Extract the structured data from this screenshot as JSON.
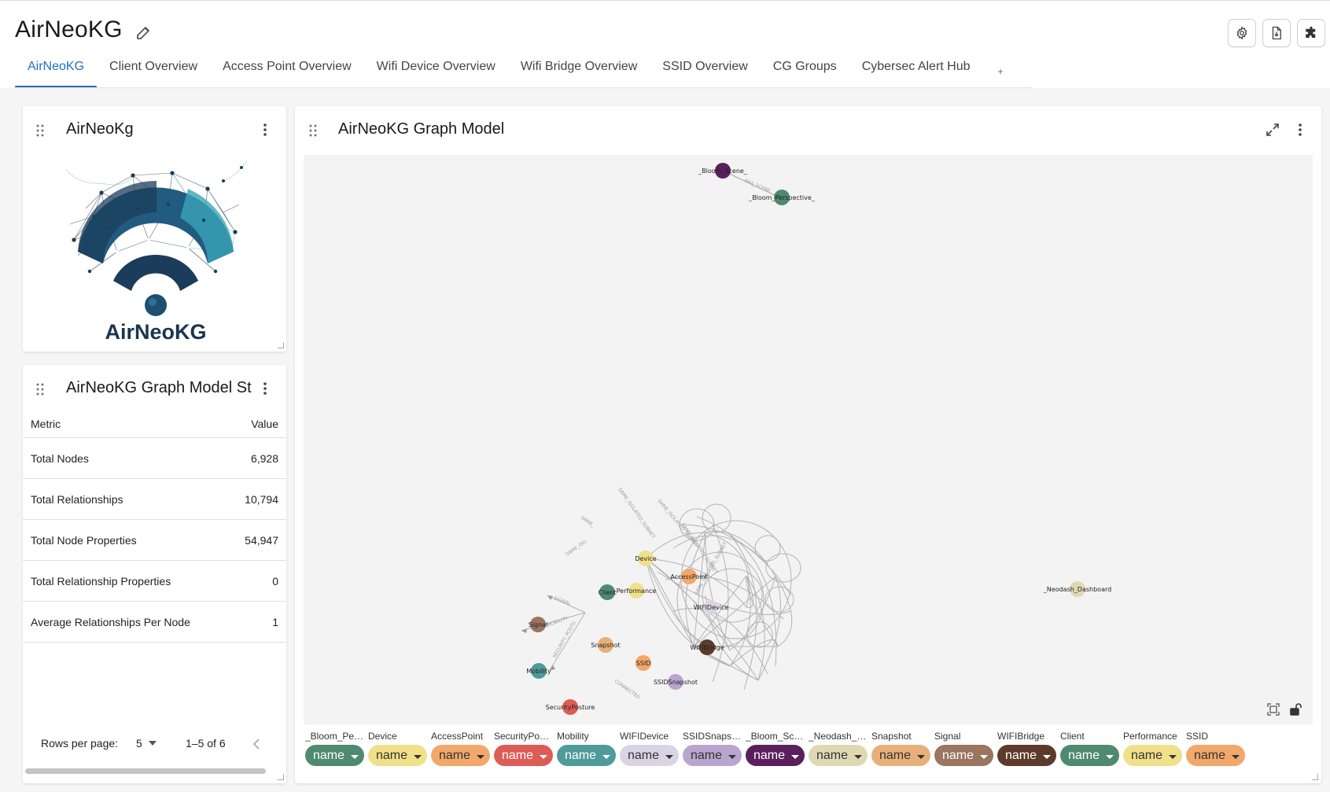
{
  "app": {
    "title": "AirNeoKG"
  },
  "header_buttons": [
    {
      "icon": "gear-icon"
    },
    {
      "icon": "export-file-icon"
    },
    {
      "icon": "puzzle-extension-icon"
    }
  ],
  "tabs": [
    {
      "label": "AirNeoKG",
      "active": true
    },
    {
      "label": "Client Overview"
    },
    {
      "label": "Access Point Overview"
    },
    {
      "label": "Wifi Device Overview"
    },
    {
      "label": "Wifi Bridge Overview"
    },
    {
      "label": "SSID Overview"
    },
    {
      "label": "CG Groups"
    },
    {
      "label": "Cybersec Alert Hub"
    }
  ],
  "logo_card": {
    "title": "AirNeoKg",
    "logo_text": "AirNeoKG"
  },
  "stats_card": {
    "title": "AirNeoKG Graph Model St",
    "columns": {
      "metric": "Metric",
      "value": "Value"
    },
    "rows": [
      {
        "metric": "Total Nodes",
        "value": "6,928"
      },
      {
        "metric": "Total Relationships",
        "value": "10,794"
      },
      {
        "metric": "Total Node Properties",
        "value": "54,947"
      },
      {
        "metric": "Total Relationship Properties",
        "value": "0"
      },
      {
        "metric": "Average Relationships Per Node",
        "value": "1"
      }
    ],
    "pagination": {
      "rows_per_page_label": "Rows per page:",
      "rows_per_page": "5",
      "range": "1–5 of 6"
    }
  },
  "graph_card": {
    "title": "AirNeoKG Graph Model",
    "nodes": [
      {
        "label": "_Bloom_Scene_",
        "color": "#5b1f5e"
      },
      {
        "label": "_Bloom_Perspective_",
        "color": "#4e8a6f"
      },
      {
        "label": "_Neodash_Dashboard",
        "color": "#dfd9b3"
      },
      {
        "label": "Device",
        "color": "#f1e08a"
      },
      {
        "label": "AccessPoint",
        "color": "#f2a86b"
      },
      {
        "label": "Client",
        "color": "#4e8a6f"
      },
      {
        "label": "Performance",
        "color": "#f1e08a"
      },
      {
        "label": "WIFIDevice",
        "color": "#d9d4e4"
      },
      {
        "label": "WIFIBridge",
        "color": "#5c3b2a"
      },
      {
        "label": "Signal",
        "color": "#9a7560"
      },
      {
        "label": "Snapshot",
        "color": "#e7b07a"
      },
      {
        "label": "SSID",
        "color": "#f2a86b"
      },
      {
        "label": "SSIDSnapshot",
        "color": "#b9a5cf"
      },
      {
        "label": "Mobility",
        "color": "#4f9a9b"
      },
      {
        "label": "SecurityPosture",
        "color": "#dd5c56"
      }
    ],
    "edge_labels": [
      "SAME_ISOLATED_SUBNET",
      "SAME_ISOLATED_SUBNET",
      "SAME_ISOLATED_SUBNET",
      "SAME_ISOLATED_SUBNET",
      "SAME_",
      "SAME_ISO",
      "SIGNAL",
      "MOBILITY",
      "SECURITY_POSTU",
      "HAS_SCENE",
      "CONNECTED"
    ],
    "legend": [
      {
        "label": "_Bloom_Pers…",
        "value": "name",
        "color": "#4e8a6f",
        "text_color": "#ffffff"
      },
      {
        "label": "Device",
        "value": "name",
        "color": "#f1e08a",
        "text_color": "#333333"
      },
      {
        "label": "AccessPoint",
        "value": "name",
        "color": "#f2a86b",
        "text_color": "#333333"
      },
      {
        "label": "SecurityPost…",
        "value": "name",
        "color": "#dd5c56",
        "text_color": "#ffffff"
      },
      {
        "label": "Mobility",
        "value": "name",
        "color": "#4f9a9b",
        "text_color": "#ffffff"
      },
      {
        "label": "WIFIDevice",
        "value": "name",
        "color": "#d9d4e4",
        "text_color": "#333333"
      },
      {
        "label": "SSIDSnapshot",
        "value": "name",
        "color": "#b9a5cf",
        "text_color": "#333333"
      },
      {
        "label": "_Bloom_Sce…",
        "value": "name",
        "color": "#5b1f5e",
        "text_color": "#ffffff"
      },
      {
        "label": "_Neodash_D…",
        "value": "name",
        "color": "#dfd9b3",
        "text_color": "#333333"
      },
      {
        "label": "Snapshot",
        "value": "name",
        "color": "#e7b07a",
        "text_color": "#333333"
      },
      {
        "label": "Signal",
        "value": "name",
        "color": "#9a7560",
        "text_color": "#ffffff"
      },
      {
        "label": "WIFIBridge",
        "value": "name",
        "color": "#5c3b2a",
        "text_color": "#ffffff"
      },
      {
        "label": "Client",
        "value": "name",
        "color": "#4e8a6f",
        "text_color": "#ffffff"
      },
      {
        "label": "Performance",
        "value": "name",
        "color": "#f1e08a",
        "text_color": "#333333"
      },
      {
        "label": "SSID",
        "value": "name",
        "color": "#f2a86b",
        "text_color": "#333333"
      }
    ]
  }
}
